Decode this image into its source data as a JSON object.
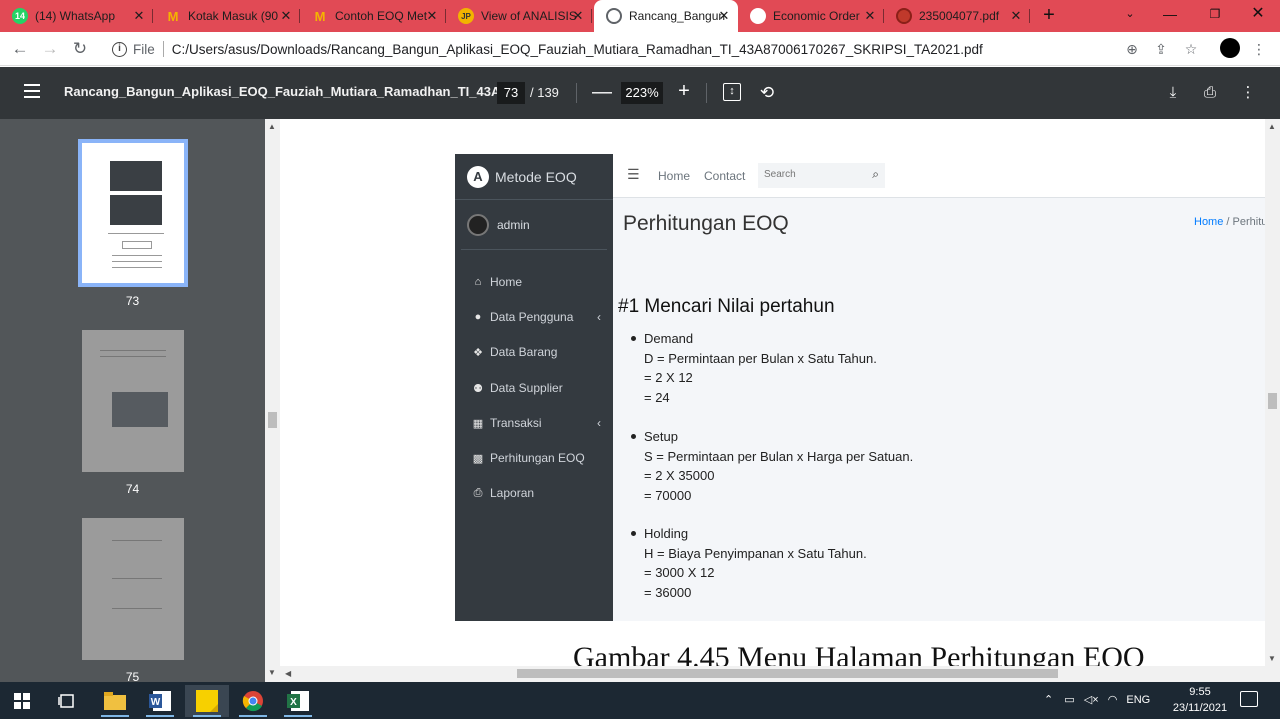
{
  "browser": {
    "tabs": [
      {
        "label": "(14) WhatsApp",
        "icon": "whatsapp-icon",
        "color": "#25d366"
      },
      {
        "label": "Kotak Masuk (90",
        "icon": "gmail-icon",
        "color": "#f4b400"
      },
      {
        "label": "Contoh EOQ Met",
        "icon": "gmail-icon",
        "color": "#f4b400"
      },
      {
        "label": "View of ANALISIS",
        "icon": "journal-icon",
        "color": "#f2b400"
      },
      {
        "label": "Rancang_Bangun",
        "icon": "globe-icon",
        "color": "#5f6368"
      },
      {
        "label": "Economic Order",
        "icon": "page-icon",
        "color": "#ffffff"
      },
      {
        "label": "235004077.pdf",
        "icon": "globe-icon",
        "color": "#c0392b"
      }
    ],
    "new_tab": "+",
    "address": {
      "scheme": "File",
      "url": "C:/Users/asus/Downloads/Rancang_Bangun_Aplikasi_EOQ_Fauziah_Mutiara_Ramadhan_TI_43A87006170267_SKRIPSI_TA2021.pdf"
    }
  },
  "pdf_toolbar": {
    "title": "Rancang_Bangun_Aplikasi_EOQ_Fauziah_Mutiara_Ramadhan_TI_43A...",
    "page_current": "73",
    "page_total": "/ 139",
    "zoom": "223%",
    "zoom_out": "—",
    "zoom_in": "+"
  },
  "thumbnails": [
    {
      "page": "73",
      "selected": true
    },
    {
      "page": "74",
      "selected": false
    },
    {
      "page": "75",
      "selected": false
    }
  ],
  "app": {
    "brand": "Metode EOQ",
    "user": "admin",
    "menu": [
      {
        "label": "Home",
        "icon": "home-icon",
        "chevron": false
      },
      {
        "label": "Data Pengguna",
        "icon": "user-icon",
        "chevron": true
      },
      {
        "label": "Data Barang",
        "icon": "cubes-icon",
        "chevron": false
      },
      {
        "label": "Data Supplier",
        "icon": "users-icon",
        "chevron": false
      },
      {
        "label": "Transaksi",
        "icon": "table-icon",
        "chevron": true
      },
      {
        "label": "Perhitungan EOQ",
        "icon": "grid-icon",
        "chevron": false
      },
      {
        "label": "Laporan",
        "icon": "print-icon",
        "chevron": false
      }
    ],
    "topnav": {
      "home": "Home",
      "contact": "Contact",
      "search_placeholder": "Search"
    },
    "page_title": "Perhitungan EOQ",
    "breadcrumb": {
      "home": "Home",
      "sep": "/",
      "current": "Perhitu"
    },
    "section_title": "#1 Mencari Nilai pertahun",
    "items": [
      {
        "heading": "Demand",
        "lines": [
          "D = Permintaan per Bulan x Satu Tahun.",
          "= 2 X 12",
          "= 24"
        ]
      },
      {
        "heading": "Setup",
        "lines": [
          "S = Permintaan per Bulan x Harga per Satuan.",
          "= 2 X 35000",
          "= 70000"
        ]
      },
      {
        "heading": "Holding",
        "lines": [
          "H = Biaya Penyimpanan x Satu Tahun.",
          "= 3000 X 12",
          "= 36000"
        ]
      }
    ]
  },
  "caption": "Gambar 4.45 Menu Halaman Perhitungan EOQ",
  "taskbar": {
    "apps": [
      "windows-start-icon",
      "task-view-icon",
      "file-explorer-icon",
      "word-icon",
      "sticky-notes-icon",
      "chrome-icon",
      "excel-icon"
    ],
    "lang": "ENG",
    "time": "9:55",
    "date": "23/11/2021"
  }
}
